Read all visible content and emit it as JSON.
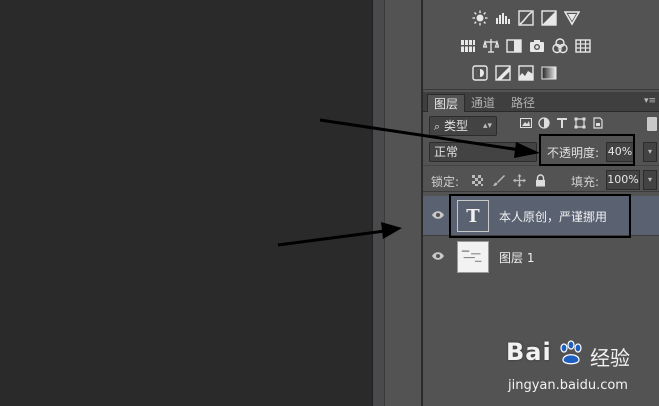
{
  "adjustments": {
    "rows": [
      [
        "brightness-contrast-icon",
        "levels-icon",
        "curves-icon",
        "exposure-icon",
        "vibrance-icon"
      ],
      [
        "hue-saturation-icon",
        "color-balance-icon",
        "black-white-icon",
        "photo-filter-icon",
        "channel-mixer-icon",
        "color-lookup-icon"
      ],
      [
        "invert-icon",
        "posterize-icon",
        "threshold-icon",
        "gradient-map-icon"
      ]
    ]
  },
  "layers_panel": {
    "tabs": [
      "图层",
      "通道",
      "路径"
    ],
    "filter": {
      "label": "类型",
      "search_icon": "search-icon"
    },
    "blend_mode": "正常",
    "opacity_label": "不透明度:",
    "opacity_value": "40%",
    "lock_label": "锁定:",
    "fill_label": "填充:",
    "fill_value": "100%",
    "layers": [
      {
        "name": "本人原创，严谨挪用",
        "kind": "text",
        "thumb_glyph": "T",
        "selected": true,
        "visible": true
      },
      {
        "name": "图层 1",
        "kind": "image",
        "selected": false,
        "visible": true
      }
    ]
  },
  "watermark": {
    "logo_text": "Bai",
    "logo_text2": "经验",
    "url": "jingyan.baidu.com"
  },
  "colors": {
    "panel_bg": "#535353",
    "selected_layer": "#5a6272",
    "canvas_bg": "#2a2a2b"
  }
}
